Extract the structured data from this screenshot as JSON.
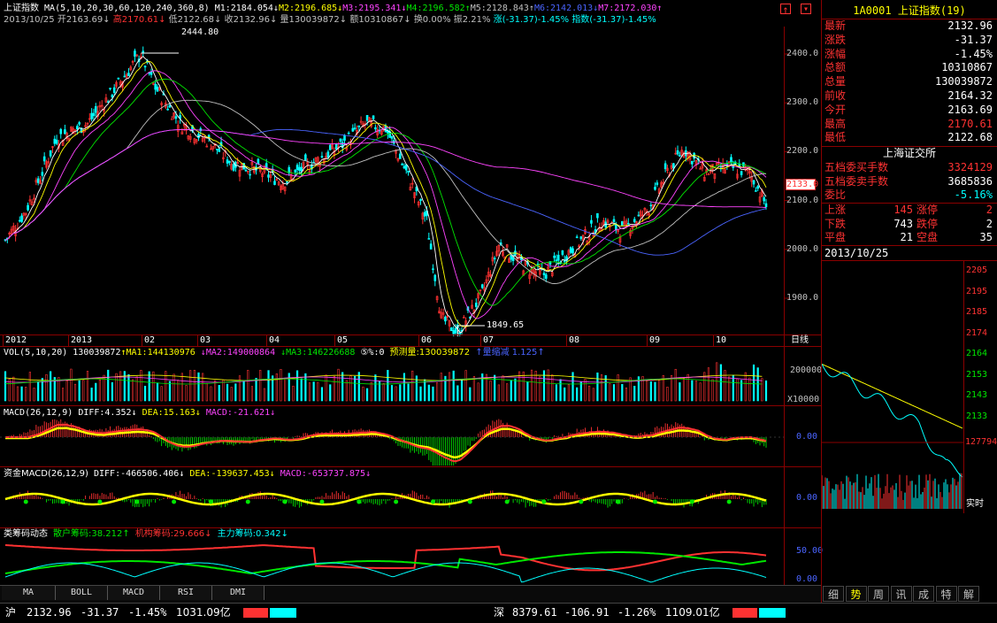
{
  "header": {
    "index_name": "上证指数",
    "ma_params": "MA(5,10,20,30,60,120,240,360,8)",
    "ma_values": [
      {
        "label": "M1:2184.054",
        "arrow": "↓",
        "color": "#ffffff"
      },
      {
        "label": "M2:2196.685",
        "arrow": "↓",
        "color": "#ffff00"
      },
      {
        "label": "M3:2195.341",
        "arrow": "↓",
        "color": "#ff44ff"
      },
      {
        "label": "M4:2196.582",
        "arrow": "↑",
        "color": "#00e600"
      },
      {
        "label": "M5:2128.843",
        "arrow": "↑",
        "color": "#c0c0c0"
      },
      {
        "label": "M6:2142.013",
        "arrow": "↓",
        "color": "#4a64ff"
      },
      {
        "label": "M7:2172.030",
        "arrow": "↑",
        "color": "#ff44ff"
      }
    ],
    "line2": [
      {
        "t": "2013/10/25",
        "c": "#c0c0c0"
      },
      {
        "t": "开2163.69↓",
        "c": "#c0c0c0"
      },
      {
        "t": "高2170.61↓",
        "c": "#ff3232"
      },
      {
        "t": "低2122.68↓",
        "c": "#c0c0c0"
      },
      {
        "t": "收2132.96↓",
        "c": "#c0c0c0"
      },
      {
        "t": "量130039872↓",
        "c": "#c0c0c0"
      },
      {
        "t": "额10310867↓",
        "c": "#c0c0c0"
      },
      {
        "t": "换0.00%",
        "c": "#c0c0c0"
      },
      {
        "t": "振2.21%",
        "c": "#c0c0c0"
      },
      {
        "t": "涨(-31.37)-1.45%",
        "c": "#00ffff"
      },
      {
        "t": "指数(-31.37)-1.45%",
        "c": "#00ffff"
      }
    ],
    "up_arrow": "↑"
  },
  "main_chart": {
    "high_label": "2444.80",
    "low_label": "1849.65",
    "current_label": "2133.0",
    "y_ticks": [
      "2400.0",
      "2300.0",
      "2200.0",
      "2100.0",
      "2000.0",
      "1900.0"
    ],
    "x_labels": [
      "2012",
      "2013",
      "02",
      "03",
      "04",
      "05",
      "06",
      "07",
      "08",
      "09",
      "10"
    ],
    "period_label": "日线"
  },
  "vol_panel": {
    "params": "VOL(5,10,20)",
    "value": "130039872",
    "ma1": "↑MA1:144130976",
    "ma2": "↓MA2:149000864",
    "ma3": "↓MA3:146226688",
    "icon5": "⑤",
    "pct": "%:0",
    "forecast": "预测量:130039872",
    "shrink": "↑量缩减 1.125↑",
    "y_tick": "200000",
    "unit": "X10000"
  },
  "macd_panel": {
    "params": "MACD(26,12,9)",
    "diff": "DIFF:4.352↓",
    "dea": "DEA:15.163↓",
    "macd": "MACD:-21.621↓",
    "y_tick": "0.00"
  },
  "fund_macd_panel": {
    "params": "资金MACD(26,12,9)",
    "diff": "DIFF:-466506.406↓",
    "dea": "DEA:-139637.453↓",
    "macd": "MACD:-653737.875↓",
    "y_tick": "0.00"
  },
  "chip_panel": {
    "title": "类筹码动态",
    "retail": "散户筹码:38.212↑",
    "inst": "机构筹码:29.666↓",
    "main": "主力筹码:0.342↓",
    "y_ticks": [
      "50.00",
      "0.00"
    ]
  },
  "bottom_tabs": [
    "MA",
    "BOLL",
    "MACD",
    "RSI",
    "DMI"
  ],
  "quote": {
    "code": "1A0001",
    "name": "上证指数",
    "count": "(19)",
    "rows": [
      {
        "k": "最新",
        "v": "2132.96",
        "c": "#ffffff"
      },
      {
        "k": "涨跌",
        "v": "-31.37",
        "c": "#ffffff"
      },
      {
        "k": "涨幅",
        "v": "-1.45%",
        "c": "#ffffff"
      },
      {
        "k": "总额",
        "v": "10310867",
        "c": "#ffffff"
      },
      {
        "k": "总量",
        "v": "130039872",
        "c": "#ffffff"
      },
      {
        "k": "前收",
        "v": "2164.32",
        "c": "#ffffff"
      },
      {
        "k": "今开",
        "v": "2163.69",
        "c": "#ffffff"
      },
      {
        "k": "最高",
        "v": "2170.61",
        "c": "#ff3232"
      },
      {
        "k": "最低",
        "v": "2122.68",
        "c": "#ffffff"
      }
    ],
    "exchange": "上海证交所",
    "buy_label": "五档委买手数",
    "buy_val": "3324129",
    "sell_label": "五档委卖手数",
    "sell_val": "3685836",
    "ratio_label": "委比",
    "ratio_val": "-5.16%",
    "breadth": [
      {
        "k1": "上涨",
        "v1": "145",
        "k2": "涨停",
        "v2": "2"
      },
      {
        "k1": "下跌",
        "v1": "743",
        "k2": "跌停",
        "v2": "2"
      },
      {
        "k1": "平盘",
        "v1": "21",
        "k2": "空盘",
        "v2": "35"
      }
    ],
    "date": "2013/10/25"
  },
  "intraday": {
    "y_ticks": [
      "2205",
      "2195",
      "2185",
      "2174",
      "2164",
      "2153",
      "2143",
      "2133"
    ],
    "vol_tick": "127794",
    "realtime": "实时"
  },
  "side_tabs": [
    "细",
    "势",
    "周",
    "讯",
    "成",
    "特",
    "解"
  ],
  "status_bar": {
    "sh_label": "沪",
    "sh_price": "2132.96",
    "sh_change": "-31.37",
    "sh_pct": "-1.45%",
    "sh_amount": "1031.09亿",
    "sz_label": "深",
    "sz_price": "8379.61",
    "sz_change": "-106.91",
    "sz_pct": "-1.26%",
    "sz_amount": "1109.01亿"
  },
  "toolbar_icons": [
    "up-arrow-icon",
    "down-arrow-icon"
  ]
}
